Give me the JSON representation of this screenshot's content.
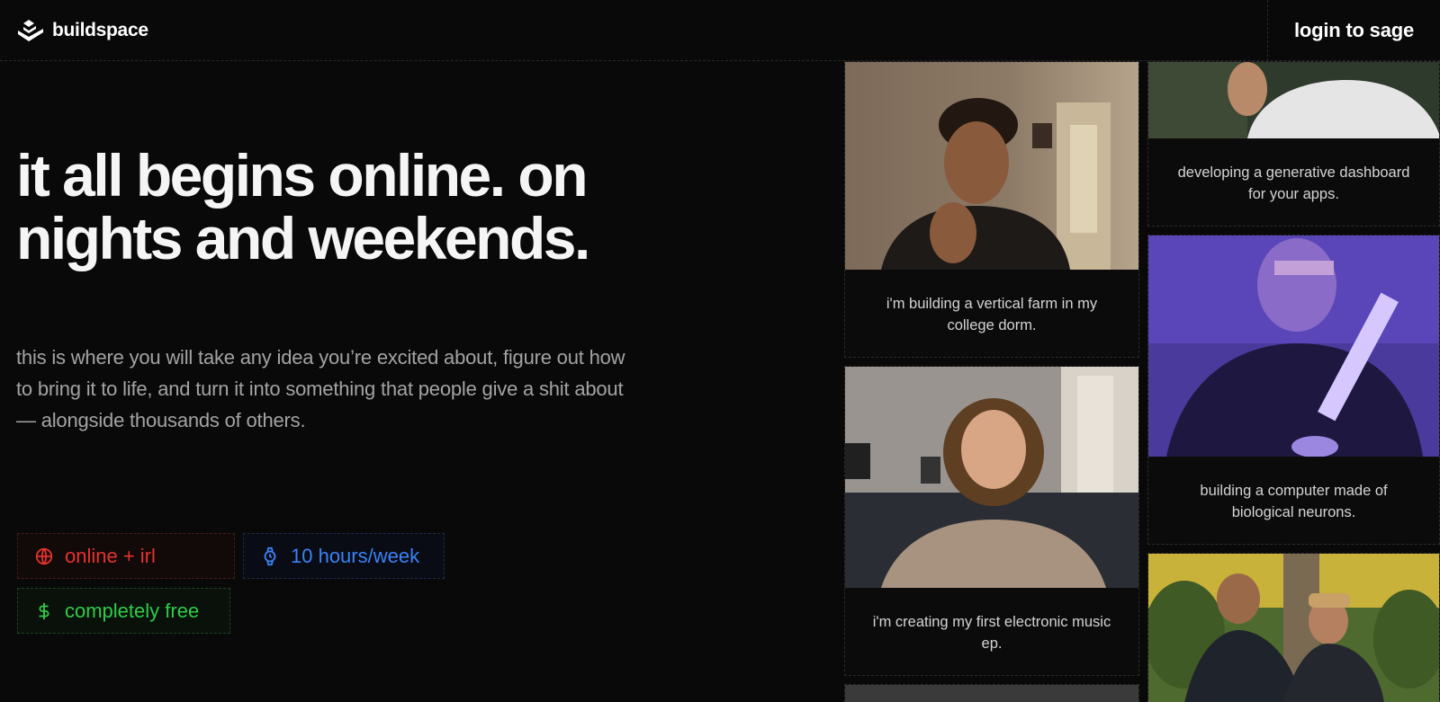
{
  "brand": {
    "name": "buildspace",
    "logo_icon": "buildspace-logo-icon"
  },
  "nav": {
    "login_label": "login to sage"
  },
  "hero": {
    "headline": "it all begins online. on nights and weekends.",
    "subtext": "this is where you will take any idea you’re excited about, figure out how to bring it to life, and turn it into something that people give a shit about — alongside thousands of others."
  },
  "badges": [
    {
      "label": "online + irl",
      "icon": "globe-icon",
      "color": "#e5322e"
    },
    {
      "label": "10 hours/week",
      "icon": "watch-icon",
      "color": "#3b82f6"
    },
    {
      "label": "completely free",
      "icon": "dollar-icon",
      "color": "#2fcc48"
    }
  ],
  "projects": [
    {
      "caption": "i'm building a vertical farm in my college dorm."
    },
    {
      "caption": "i'm creating my first electronic music ep."
    },
    {
      "caption": "developing a generative dashboard for your apps."
    },
    {
      "caption": "building a computer made of biological neurons."
    }
  ]
}
